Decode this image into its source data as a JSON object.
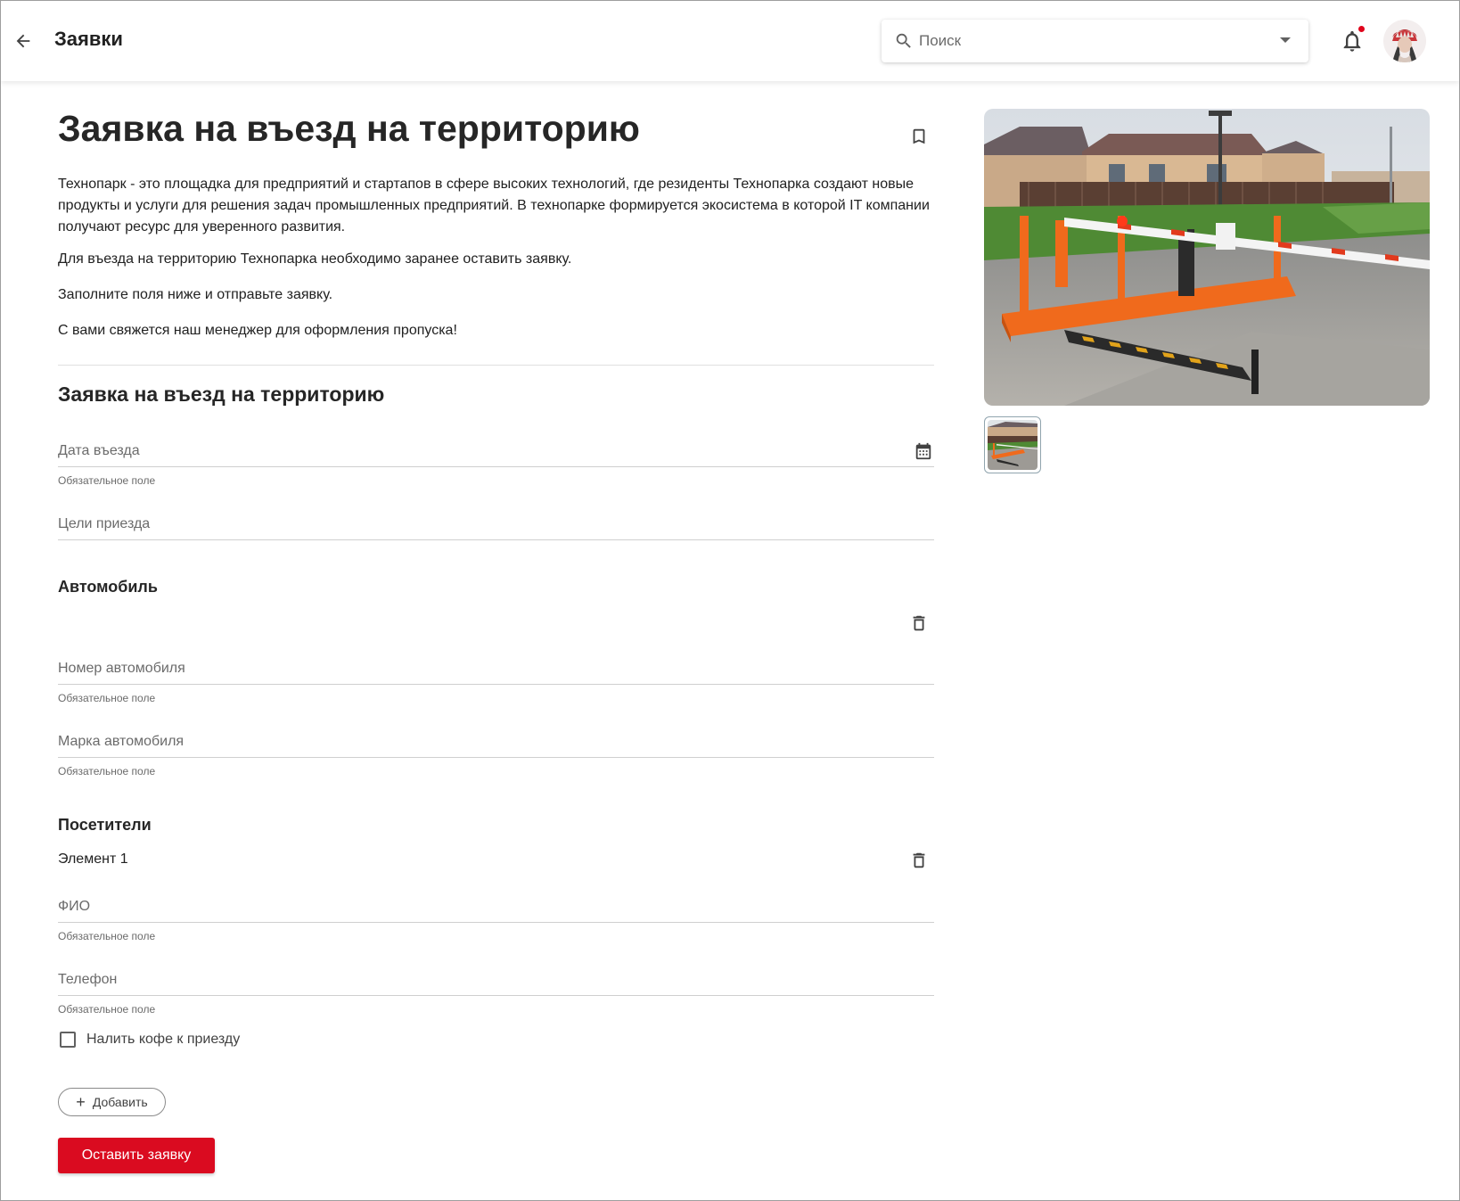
{
  "header": {
    "title": "Заявки",
    "search_placeholder": "Поиск"
  },
  "colors": {
    "accent": "#da0b20",
    "notification_dot": "#e0041c",
    "barrier_orange": "#f06a1c"
  },
  "icons": {
    "back": "arrow-left-icon",
    "search": "search-icon",
    "dropdown": "chevron-down-icon",
    "notifications": "bell-icon",
    "bookmark": "bookmark-icon",
    "calendar": "calendar-icon",
    "delete": "trash-icon",
    "add": "plus-icon"
  },
  "main": {
    "title": "Заявка на въезд на территорию",
    "paragraphs": [
      "Технопарк - это площадка для предприятий и стартапов в сфере высоких технологий, где резиденты Технопарка создают новые продукты и услуги для решения задач промышленных предприятий. В технопарке формируется экосистема в которой IT компании получают ресурс для уверенного развития.",
      "Для въезда на территорию Технопарка необходимо заранее оставить заявку.",
      "Заполните поля ниже и отправьте заявку.",
      "С вами свяжется наш менеджер для оформления пропуска!"
    ],
    "form_title": "Заявка на въезд на территорию",
    "fields": {
      "entry_date": {
        "label": "Дата въезда",
        "help": "Обязательное поле"
      },
      "purpose": {
        "label": "Цели приезда"
      }
    },
    "car_section": {
      "title": "Автомобиль",
      "fields": {
        "number": {
          "label": "Номер автомобиля",
          "help": "Обязательное поле"
        },
        "brand": {
          "label": "Марка автомобиля",
          "help": "Обязательное поле"
        }
      }
    },
    "visitors_section": {
      "title": "Посетители",
      "item_label": "Элемент 1",
      "fields": {
        "fio": {
          "label": "ФИО",
          "help": "Обязательное поле"
        },
        "phone": {
          "label": "Телефон",
          "help": "Обязательное поле"
        }
      },
      "checkbox_label": "Налить кофе к приезду",
      "checkbox_checked": false
    },
    "add_button": "Добавить",
    "submit_button": "Оставить заявку"
  }
}
